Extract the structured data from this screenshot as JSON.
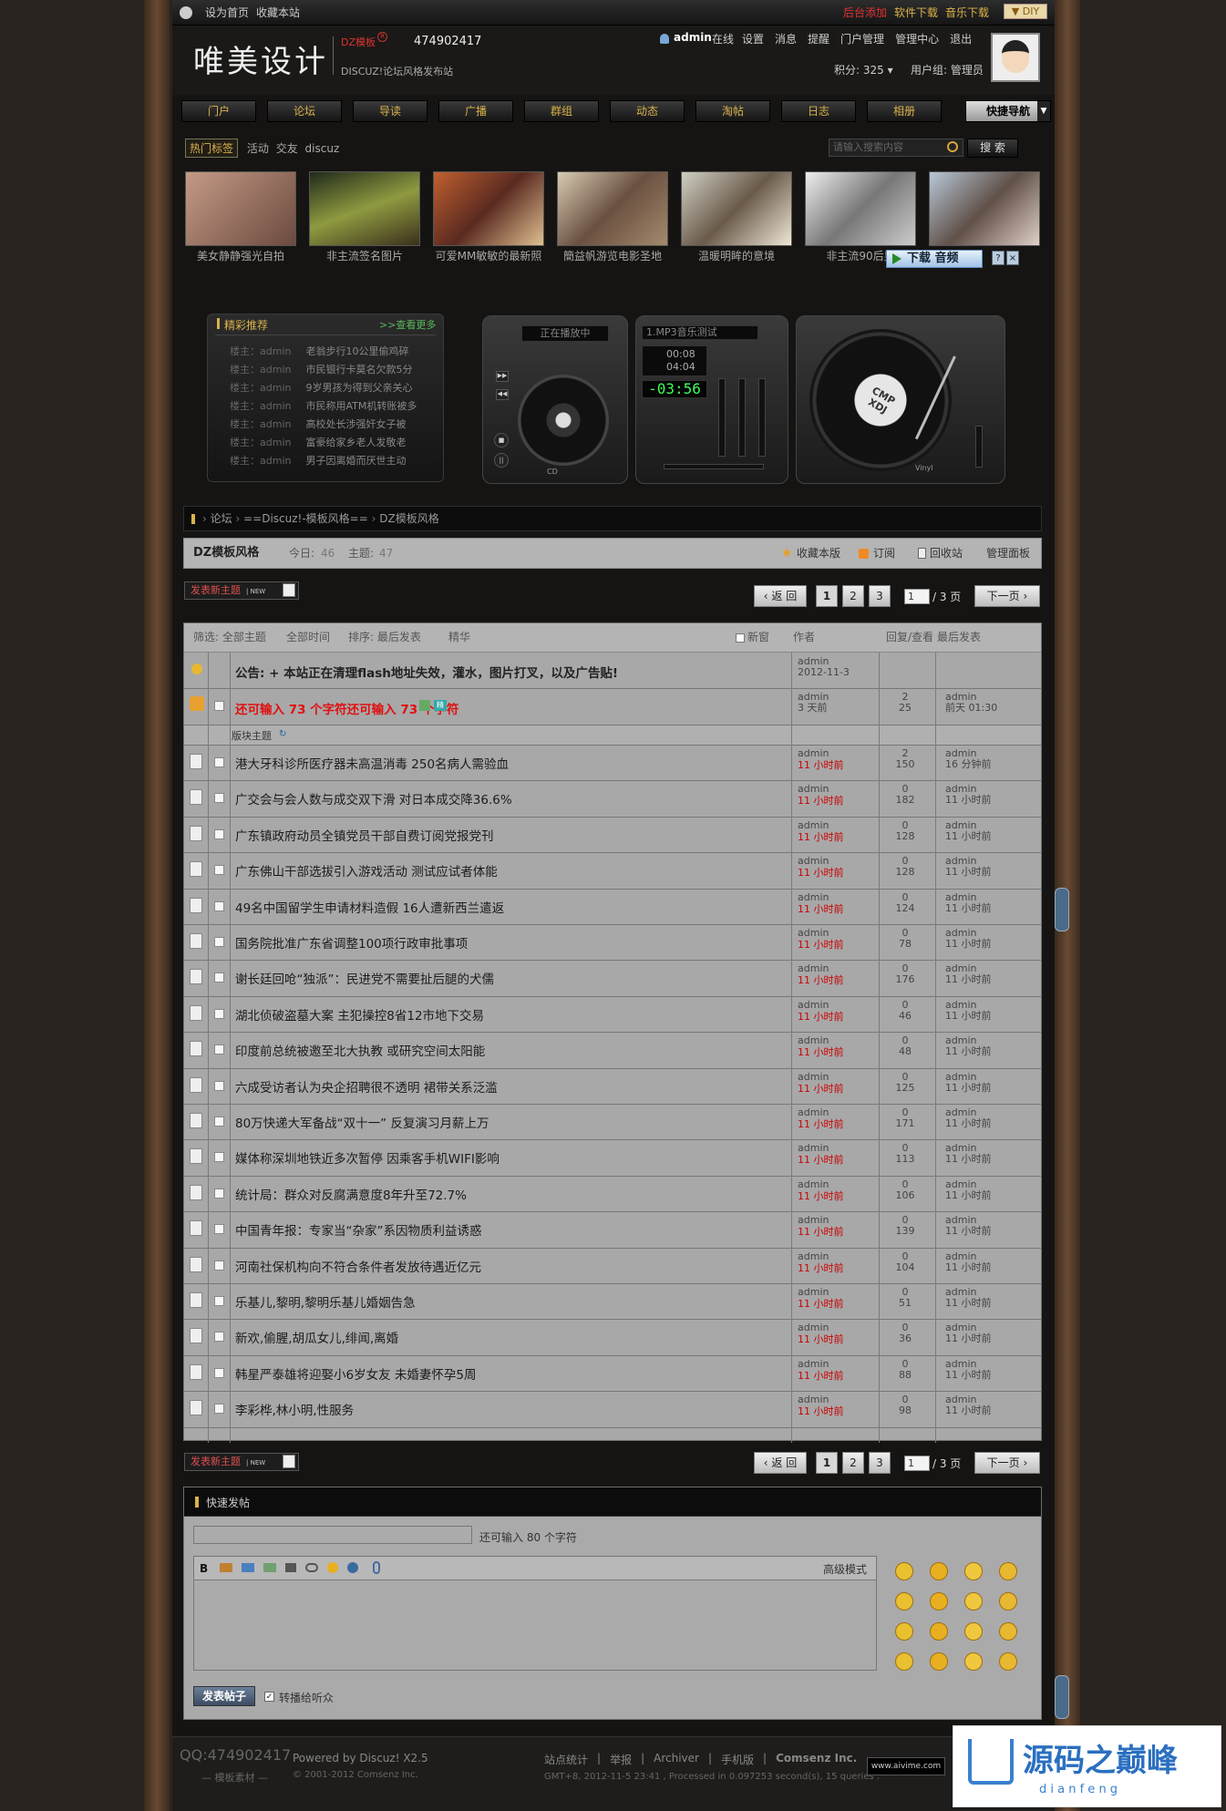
{
  "topbar": {
    "home": "设为首页",
    "fav": "收藏本站",
    "backend": "后台添加",
    "soft": "软件下载",
    "music": "音乐下载",
    "diy": "DIY"
  },
  "header": {
    "logo": "唯美设计",
    "brand": "DZ模板",
    "qq": "474902417",
    "subline": "DISCUZ!论坛风格发布站",
    "user": "admin",
    "online": "在线",
    "links": [
      "设置",
      "消息",
      "提醒",
      "门户管理",
      "管理中心",
      "退出"
    ],
    "points": "积分: 325",
    "group": "用户组: 管理员"
  },
  "nav": {
    "items": [
      "门户",
      "论坛",
      "导读",
      "广播",
      "群组",
      "动态",
      "淘帖",
      "日志",
      "相册"
    ],
    "quick": "快捷导航"
  },
  "tags": {
    "label": "热门标签",
    "items": [
      "活动",
      "交友",
      "discuz"
    ],
    "search_placeholder": "请输入搜索内容",
    "search_btn": "搜 索"
  },
  "pics": [
    "美女静静强光自拍",
    "非主流签名图片",
    "可爱MM敏敏的最新照",
    "簡益帆游览电影圣地",
    "温暖明眸的意境",
    "非主流90后男"
  ],
  "download": "下载 音频",
  "recommend": {
    "title": "精彩推荐",
    "more": ">>查看更多",
    "items": [
      {
        "who": "楼主：admin",
        "t": "老翁步行10公里偷鸡碎"
      },
      {
        "who": "楼主：admin",
        "t": "市民银行卡莫名欠款5分"
      },
      {
        "who": "楼主：admin",
        "t": "9岁男孩为得到父亲关心"
      },
      {
        "who": "楼主：admin",
        "t": "市民称用ATM机转账被多"
      },
      {
        "who": "楼主：admin",
        "t": "高校处长涉强奸女子被"
      },
      {
        "who": "楼主：admin",
        "t": "富豪给家乡老人发敬老"
      },
      {
        "who": "楼主：admin",
        "t": "男子因离婚而厌世主动"
      }
    ]
  },
  "player": {
    "playing": "正在播放中",
    "track": "1.MP3音乐测试",
    "time1": "00:08",
    "time2": "04:04",
    "clock": "-03:56",
    "cd": "CD",
    "vinyl": "Vinyl",
    "badge": "CMP XDJ"
  },
  "breadcrumb": [
    "论坛",
    "==Discuz!-模板风格==",
    "DZ模板风格"
  ],
  "forum": {
    "name": "DZ模板风格",
    "today_label": "今日:",
    "today": "46",
    "topics_label": "主题:",
    "topics": "47",
    "actions": [
      "收藏本版",
      "订阅",
      "回收站",
      "管理面板"
    ]
  },
  "newpost": "发表新主题",
  "pager": {
    "back": "返 回",
    "pages": [
      "1",
      "2",
      "3"
    ],
    "input": "1",
    "total": "/ 3 页",
    "next": "下一页"
  },
  "filters": {
    "a": "筛选: 全部主题",
    "b": "全部时间",
    "c": "排序: 最后发表",
    "d": "精华",
    "newwin": "新窗",
    "author": "作者",
    "reply": "回复/查看",
    "last": "最后发表"
  },
  "notice": {
    "title": "公告: + 本站正在清理flash地址失效，灌水，图片打叉，以及广告贴!",
    "author": "admin",
    "date": "2012-11-3"
  },
  "sticky": {
    "title": "还可输入 73 个字符还可输入 73 个字符",
    "author": "admin",
    "date": "3 天前",
    "replies": "2",
    "views": "25",
    "last": "admin",
    "lasttime": "前天 01:30"
  },
  "section": "版块主题",
  "threads": [
    {
      "t": "港大牙科诊所医疗器未高温消毒 250名病人需验血",
      "r": "2",
      "v": "150",
      "lt": "16 分钟前"
    },
    {
      "t": "广交会与会人数与成交双下滑 对日本成交降36.6%",
      "r": "0",
      "v": "182",
      "lt": "11 小时前"
    },
    {
      "t": "广东镇政府动员全镇党员干部自费订阅党报党刊",
      "r": "0",
      "v": "128",
      "lt": "11 小时前"
    },
    {
      "t": "广东佛山干部选拔引入游戏活动 测试应试者体能",
      "r": "0",
      "v": "128",
      "lt": "11 小时前"
    },
    {
      "t": "49名中国留学生申请材料造假 16人遭新西兰遣返",
      "r": "0",
      "v": "124",
      "lt": "11 小时前"
    },
    {
      "t": "国务院批准广东省调整100项行政审批事项",
      "r": "0",
      "v": "78",
      "lt": "11 小时前"
    },
    {
      "t": "谢长廷回呛“独派”：民进党不需要扯后腿的犬儒",
      "r": "0",
      "v": "176",
      "lt": "11 小时前"
    },
    {
      "t": "湖北侦破盗墓大案 主犯操控8省12市地下交易",
      "r": "0",
      "v": "46",
      "lt": "11 小时前"
    },
    {
      "t": "印度前总统被邀至北大执教 或研究空间太阳能",
      "r": "0",
      "v": "48",
      "lt": "11 小时前"
    },
    {
      "t": "六成受访者认为央企招聘很不透明 裙带关系泛滥",
      "r": "0",
      "v": "125",
      "lt": "11 小时前"
    },
    {
      "t": "80万快递大军备战“双十一” 反复演习月薪上万",
      "r": "0",
      "v": "171",
      "lt": "11 小时前"
    },
    {
      "t": "媒体称深圳地铁近多次暂停 因乘客手机WIFI影响",
      "r": "0",
      "v": "113",
      "lt": "11 小时前"
    },
    {
      "t": "统计局：群众对反腐满意度8年升至72.7%",
      "r": "0",
      "v": "106",
      "lt": "11 小时前"
    },
    {
      "t": "中国青年报：专家当“杂家”系因物质利益诱惑",
      "r": "0",
      "v": "139",
      "lt": "11 小时前"
    },
    {
      "t": "河南社保机构向不符合条件者发放待遇近亿元",
      "r": "0",
      "v": "104",
      "lt": "11 小时前"
    },
    {
      "t": "乐基儿,黎明,黎明乐基儿婚姻告急",
      "r": "0",
      "v": "51",
      "lt": "11 小时前"
    },
    {
      "t": "新欢,偷腥,胡瓜女儿,绯闻,离婚",
      "r": "0",
      "v": "36",
      "lt": "11 小时前"
    },
    {
      "t": "韩星严泰雄将迎娶小6岁女友 未婚妻怀孕5周",
      "r": "0",
      "v": "88",
      "lt": "11 小时前"
    },
    {
      "t": "李彩桦,林小明,性服务",
      "r": "0",
      "v": "98",
      "lt": "11 小时前"
    }
  ],
  "thread_author": "admin",
  "thread_time": "11 小时前",
  "quick": {
    "title": "快速发帖",
    "remain": "还可输入 80 个字符",
    "advanced": "高级模式",
    "submit": "发表帖子",
    "share": "转播给听众"
  },
  "footer": {
    "qq": "QQ:474902417",
    "tpl": "模板素材",
    "powered": "Powered by Discuz! X2.5",
    "copy": "© 2001-2012 Comsenz Inc.",
    "links": [
      "站点统计",
      "举报",
      "Archiver",
      "手机版",
      "Comsenz Inc."
    ],
    "gmt": "GMT+8, 2012-11-5 23:41 , Processed in 0.097253 second(s), 15 queries .",
    "badge": "www.aivime.com",
    "wm": "源码之巅峰",
    "wm2": "d i a n f e n g"
  }
}
